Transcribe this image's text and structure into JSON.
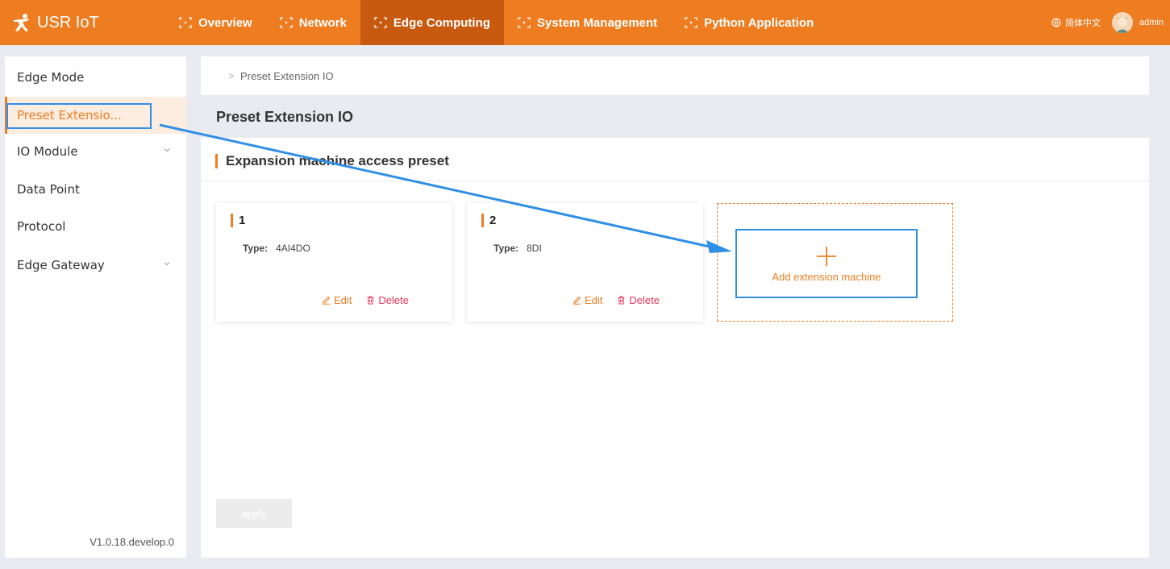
{
  "header": {
    "brand": "USR IoT",
    "nav": [
      {
        "label": "Overview",
        "active": false
      },
      {
        "label": "Network",
        "active": false
      },
      {
        "label": "Edge Computing",
        "active": true
      },
      {
        "label": "System Management",
        "active": false
      },
      {
        "label": "Python Application",
        "active": false
      }
    ],
    "language": "简体中文",
    "user": "admin"
  },
  "sidebar": {
    "items": [
      {
        "label": "Edge Mode",
        "active": false,
        "expandable": false
      },
      {
        "label": "Preset Extensio...",
        "active": true,
        "expandable": false
      },
      {
        "label": "IO Module",
        "active": false,
        "expandable": true
      },
      {
        "label": "Data Point",
        "active": false,
        "expandable": false
      },
      {
        "label": "Protocol",
        "active": false,
        "expandable": false
      },
      {
        "label": "Edge Gateway",
        "active": false,
        "expandable": true
      }
    ],
    "version": "V1.0.18.develop.0"
  },
  "breadcrumb": {
    "sep": ">",
    "current": "Preset Extension IO"
  },
  "page": {
    "title": "Preset Extension IO",
    "section_title": "Expansion machine access preset",
    "type_label": "Type:",
    "edit_label": "Edit",
    "delete_label": "Delete",
    "cards": [
      {
        "number": "1",
        "type": "4AI4DO"
      },
      {
        "number": "2",
        "type": "8DI"
      }
    ],
    "add_label": "Add extension machine",
    "apply_label": "apply"
  },
  "colors": {
    "accent": "#ee7d22",
    "nav_active": "#c85a10",
    "delete": "#e8345a",
    "annotation": "#2f8fe6"
  }
}
